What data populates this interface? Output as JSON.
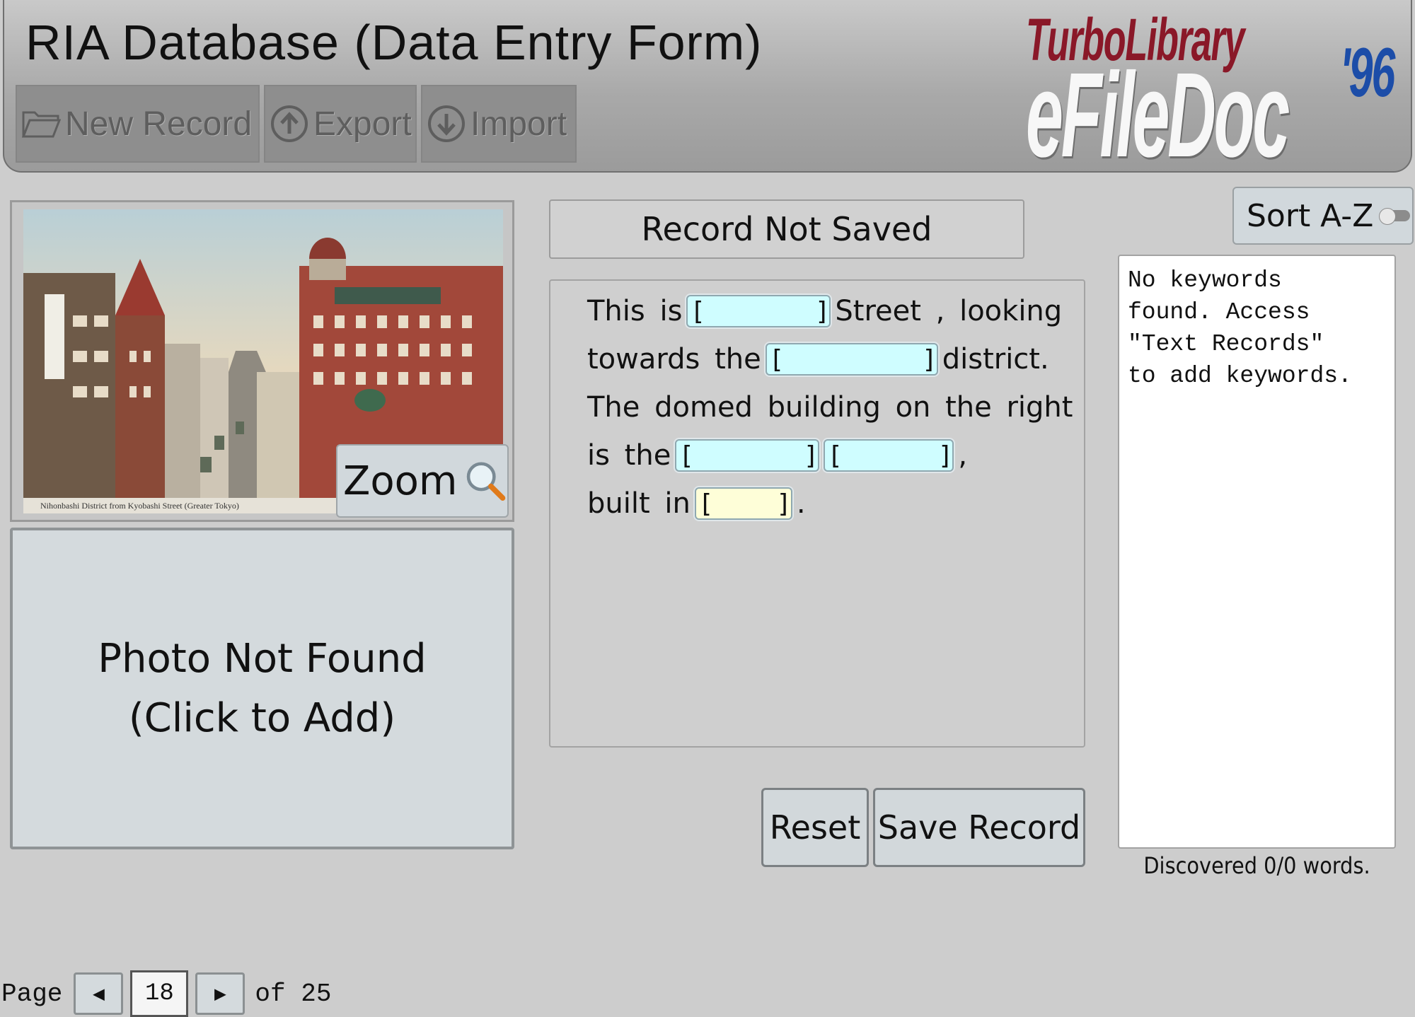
{
  "header": {
    "title": "RIA Database (Data Entry Form)",
    "toolbar": {
      "new_record": "New Record",
      "export": "Export",
      "import": "Import"
    },
    "brand": {
      "line1": "TurboLibrary",
      "line2": "eFileDoc",
      "year": "'96"
    }
  },
  "photo": {
    "caption": "Nihonbashi District from Kyobashi Street (Greater Tokyo)",
    "zoom_label": "Zoom"
  },
  "second_photo": {
    "line1": "Photo Not Found",
    "line2": "(Click to Add)"
  },
  "status": "Record Not Saved",
  "form": {
    "line1_a": "This is",
    "line1_b": "Street , looking",
    "line2_a": "towards the",
    "line2_b": "district.",
    "line3": "The domed building on the right",
    "line4_a": "is the",
    "line4_b": ",",
    "line5_a": "built in",
    "line5_b": ".",
    "field_open": "[",
    "field_close": "]"
  },
  "buttons": {
    "reset": "Reset",
    "save": "Save Record"
  },
  "keywords": {
    "sort_label": "Sort A-Z",
    "text": "No keywords\nfound. Access\n\"Text Records\"\nto add keywords.",
    "count": "Discovered 0/0 words."
  },
  "pager": {
    "label": "Page",
    "current": "18",
    "of_label": "of 25"
  }
}
